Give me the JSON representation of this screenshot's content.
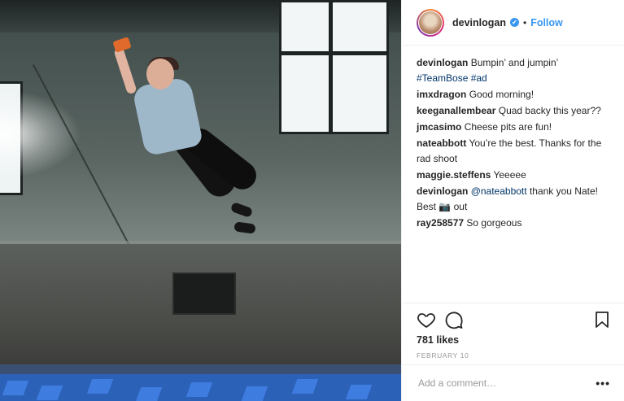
{
  "post": {
    "username": "devinlogan",
    "verified_glyph": "✔",
    "separator": "•",
    "follow_label": "Follow"
  },
  "caption": {
    "user": "devinlogan",
    "text": "Bumpin’ and jumpin’",
    "hashtags": "#TeamBose #ad"
  },
  "comments": [
    {
      "user": "imxdragon",
      "text": "Good morning!"
    },
    {
      "user": "keeganallembear",
      "text": "Quad backy this year??"
    },
    {
      "user": "jmcasimo",
      "text": "Cheese pits are fun!"
    },
    {
      "user": "nateabbott",
      "text": "You’re the best. Thanks for the rad shoot"
    },
    {
      "user": "maggie.steffens",
      "text": "Yeeeee"
    },
    {
      "user": "devinlogan",
      "mention": "@nateabbott",
      "text": "thank you Nate! Best 📷 out"
    },
    {
      "user": "ray258577",
      "text": "So gorgeous"
    }
  ],
  "stats": {
    "likes": "781 likes",
    "date": "FEBRUARY 10"
  },
  "add_comment": {
    "placeholder": "Add a comment…",
    "more": "•••"
  },
  "icons": {
    "like": "heart-icon",
    "comment": "comment-bubble-icon",
    "save": "bookmark-icon",
    "verified": "verified-badge-icon"
  },
  "colors": {
    "link_blue": "#3897f0",
    "hashtag_blue": "#003569",
    "text": "#262626",
    "muted": "#999999"
  }
}
